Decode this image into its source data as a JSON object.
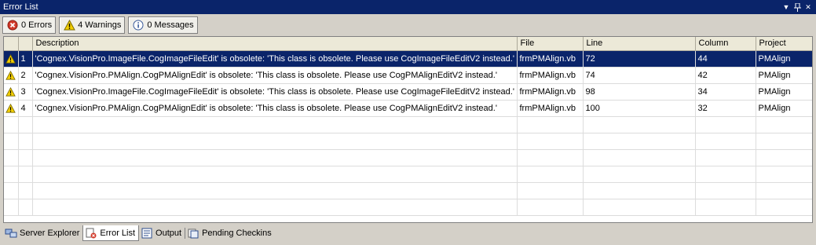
{
  "window": {
    "title": "Error List"
  },
  "filters": {
    "errors_label": "0 Errors",
    "warnings_label": "4 Warnings",
    "messages_label": "0 Messages"
  },
  "table": {
    "columns": [
      "",
      "",
      "Description",
      "File",
      "Line",
      "Column",
      "Project"
    ],
    "rows": [
      {
        "num": "1",
        "description": "'Cognex.VisionPro.ImageFile.CogImageFileEdit' is obsolete: 'This class is obsolete.  Please use CogImageFileEditV2 instead.'",
        "file": "frmPMAlign.vb",
        "line": "72",
        "column": "44",
        "project": "PMAlign"
      },
      {
        "num": "2",
        "description": "'Cognex.VisionPro.PMAlign.CogPMAlignEdit' is obsolete: 'This class is obsolete.  Please use CogPMAlignEditV2 instead.'",
        "file": "frmPMAlign.vb",
        "line": "74",
        "column": "42",
        "project": "PMAlign"
      },
      {
        "num": "3",
        "description": "'Cognex.VisionPro.ImageFile.CogImageFileEdit' is obsolete: 'This class is obsolete.  Please use CogImageFileEditV2 instead.'",
        "file": "frmPMAlign.vb",
        "line": "98",
        "column": "34",
        "project": "PMAlign"
      },
      {
        "num": "4",
        "description": "'Cognex.VisionPro.PMAlign.CogPMAlignEdit' is obsolete: 'This class is obsolete.  Please use CogPMAlignEditV2 instead.'",
        "file": "frmPMAlign.vb",
        "line": "100",
        "column": "32",
        "project": "PMAlign"
      }
    ]
  },
  "tabs": {
    "server_explorer": "Server Explorer",
    "error_list": "Error List",
    "output": "Output",
    "pending_checkins": "Pending Checkins"
  },
  "colors": {
    "title_bar": "#0a246a",
    "selection": "#0a246a",
    "warning": "#f5d000",
    "error": "#d23a2a"
  }
}
